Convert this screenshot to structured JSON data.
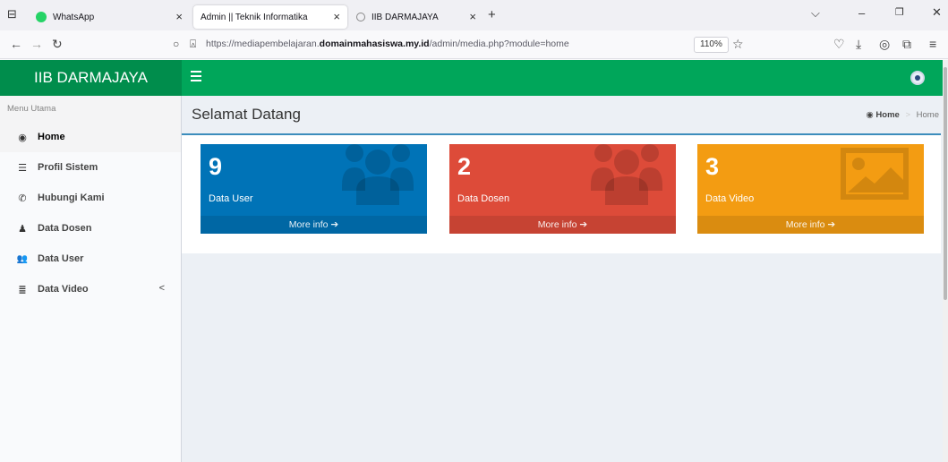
{
  "browser": {
    "tabs": [
      {
        "title": "WhatsApp",
        "favicon_color": "#25d366"
      },
      {
        "title": "Admin || Teknik Informatika",
        "favicon_color": ""
      },
      {
        "title": "IIB DARMAJAYA",
        "favicon_color": "#888888"
      }
    ],
    "close_glyph": "×",
    "new_tab_glyph": "+",
    "url_prefix": "https://mediapembelajaran.",
    "url_domain": "domainmahasiswa.my.id",
    "url_path": "/admin/media.php?module=home",
    "zoom": "110%"
  },
  "app": {
    "brand": "IIB DARMAJAYA",
    "accent": "#00a65a"
  },
  "sidebar": {
    "header": "Menu Utama",
    "items": [
      {
        "label": "Home",
        "icon": "dashboard-icon",
        "glyph": "◉"
      },
      {
        "label": "Profil Sistem",
        "icon": "list-icon",
        "glyph": "☰"
      },
      {
        "label": "Hubungi Kami",
        "icon": "phone-icon",
        "glyph": "✆"
      },
      {
        "label": "Data Dosen",
        "icon": "user-icon",
        "glyph": "♟"
      },
      {
        "label": "Data User",
        "icon": "users-icon",
        "glyph": "👥"
      },
      {
        "label": "Data Video",
        "icon": "database-icon",
        "glyph": "≣"
      }
    ],
    "expand_glyph": "<"
  },
  "content": {
    "title": "Selamat Datang",
    "breadcrumb": {
      "home": "Home",
      "separator": ">",
      "current": "Home"
    },
    "boxes": [
      {
        "number": "9",
        "label": "Data User",
        "link": "More info ➔",
        "color": "#0073b7",
        "icon": "users-icon"
      },
      {
        "number": "2",
        "label": "Data Dosen",
        "link": "More info ➔",
        "color": "#dd4b39",
        "icon": "users-icon"
      },
      {
        "number": "3",
        "label": "Data Video",
        "link": "More info ➔",
        "color": "#f39c12",
        "icon": "image-icon"
      }
    ]
  }
}
